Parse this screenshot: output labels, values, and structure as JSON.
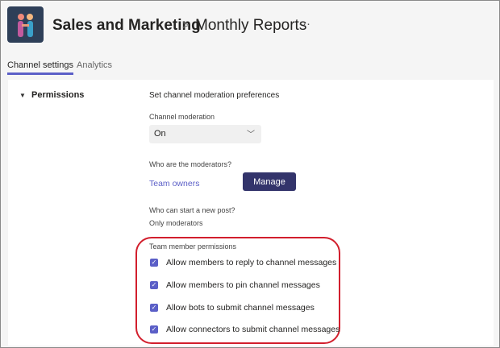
{
  "header": {
    "team": "Sales and Marketing",
    "separator": ">",
    "channel": "Monthly Reports",
    "more": "···"
  },
  "tabs": [
    {
      "label": "Channel settings",
      "active": true
    },
    {
      "label": "Analytics",
      "active": false
    }
  ],
  "section": {
    "title": "Permissions",
    "heading": "Set channel moderation preferences",
    "moderation": {
      "label": "Channel moderation",
      "value": "On"
    },
    "moderators": {
      "label": "Who are the moderators?",
      "value": "Team owners",
      "button": "Manage"
    },
    "new_post": {
      "label": "Who can start a new post?",
      "value": "Only moderators"
    },
    "member_permissions": {
      "label": "Team member permissions",
      "items": [
        {
          "label": "Allow members to reply to channel messages",
          "checked": true
        },
        {
          "label": "Allow members to pin channel messages",
          "checked": true
        },
        {
          "label": "Allow bots to submit channel messages",
          "checked": true
        },
        {
          "label": "Allow connectors to submit channel messages",
          "checked": true
        }
      ]
    }
  },
  "colors": {
    "accent": "#5b5fc7",
    "button": "#33346b",
    "highlight": "#d21f2d"
  }
}
